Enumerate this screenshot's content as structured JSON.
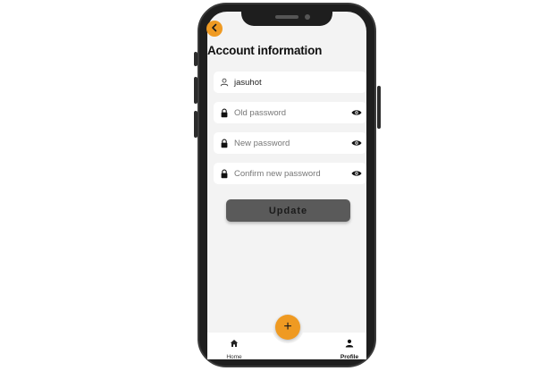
{
  "header": {
    "title": "Account information"
  },
  "form": {
    "username": {
      "value": "jasuhot",
      "icon": "person-icon"
    },
    "old_password": {
      "placeholder": "Old password",
      "icon": "lock-icon"
    },
    "new_password": {
      "placeholder": "New password",
      "icon": "lock-icon"
    },
    "confirm_password": {
      "placeholder": "Confirm new password",
      "icon": "lock-icon"
    },
    "update_label": "Update"
  },
  "fab": {
    "label": "+"
  },
  "nav": {
    "home_label": "Home",
    "profile_label": "Profile",
    "active": "Profile"
  },
  "colors": {
    "accent": "#ef9a22",
    "button": "#5a5a5a",
    "screen_bg": "#f3f3f3"
  }
}
